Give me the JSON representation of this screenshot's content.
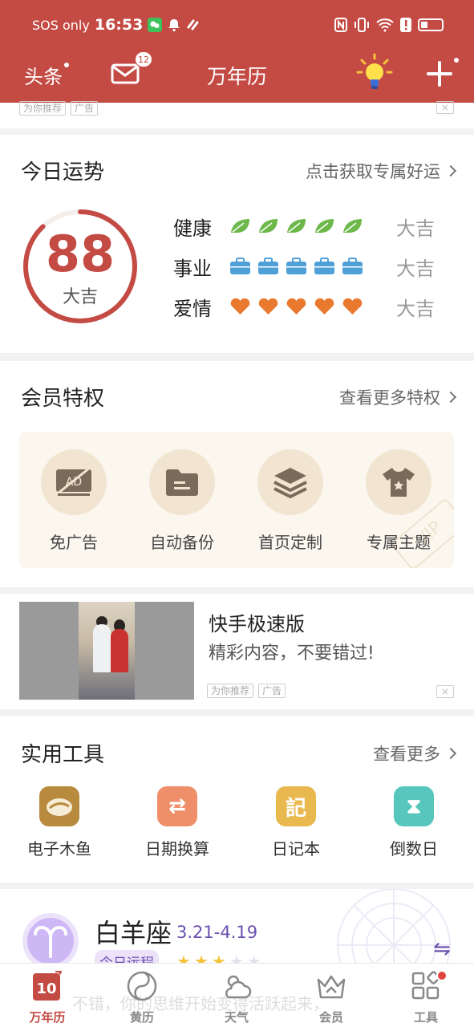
{
  "status_bar": {
    "carrier": "SOS only",
    "time": "16:53",
    "battery_level": 0.2
  },
  "app_bar": {
    "left_label": "头条",
    "mail_badge": "12",
    "title": "万年历",
    "icons": [
      "mail-icon",
      "lightbulb-icon",
      "plus-icon"
    ]
  },
  "top_ad": {
    "tag_recommend": "为你推荐",
    "tag_ad": "广告",
    "close": "×"
  },
  "fortune": {
    "title": "今日运势",
    "more": "点击获取专属好运",
    "score": "88",
    "score_label": "大吉",
    "score_ratio": 0.88,
    "rows": [
      {
        "name": "健康",
        "level": "大吉",
        "count": 5,
        "icon": "leaf-icon",
        "color": "#6db84a"
      },
      {
        "name": "事业",
        "level": "大吉",
        "count": 5,
        "icon": "briefcase-icon",
        "color": "#4f9fd8"
      },
      {
        "name": "爱情",
        "level": "大吉",
        "count": 5,
        "icon": "heart-icon",
        "color": "#e9792e"
      }
    ]
  },
  "member": {
    "title": "会员特权",
    "more": "查看更多特权",
    "perks": [
      {
        "label": "免广告",
        "icon": "no-ad-icon"
      },
      {
        "label": "自动备份",
        "icon": "folder-icon"
      },
      {
        "label": "首页定制",
        "icon": "layers-icon"
      },
      {
        "label": "专属主题",
        "icon": "tshirt-icon"
      }
    ],
    "watermark": "VIP"
  },
  "ad_card": {
    "title": "快手极速版",
    "subtitle": "精彩内容，不要错过!",
    "tag_recommend": "为你推荐",
    "tag_ad": "广告",
    "close": "×"
  },
  "tools": {
    "title": "实用工具",
    "more": "查看更多",
    "items": [
      {
        "label": "电子木鱼",
        "icon": "wooden-fish-icon",
        "color": "#b88a3e",
        "glyph": ""
      },
      {
        "label": "日期换算",
        "icon": "calendar-convert-icon",
        "color": "#ef8f6a",
        "glyph": "⇄"
      },
      {
        "label": "日记本",
        "icon": "diary-icon",
        "color": "#e9b94f",
        "glyph": "記"
      },
      {
        "label": "倒数日",
        "icon": "hourglass-icon",
        "color": "#57c7bd",
        "glyph": "⧗"
      }
    ]
  },
  "horoscope": {
    "sign": "白羊座",
    "range": "3.21-4.19",
    "tab": "今日运程",
    "stars_filled": 3,
    "stars_total": 5,
    "faded_text": "不错，你的思维开始变得活跃起来，"
  },
  "bottom_nav": [
    {
      "label": "万年历",
      "icon": "calendar-icon",
      "active": true,
      "date": "10"
    },
    {
      "label": "黄历",
      "icon": "yinyang-icon",
      "active": false
    },
    {
      "label": "天气",
      "icon": "weather-icon",
      "active": false
    },
    {
      "label": "会员",
      "icon": "crown-icon",
      "active": false
    },
    {
      "label": "工具",
      "icon": "tools-grid-icon",
      "active": false
    }
  ],
  "colors": {
    "brand": "#c44a44",
    "purple": "#6a4fb0"
  }
}
